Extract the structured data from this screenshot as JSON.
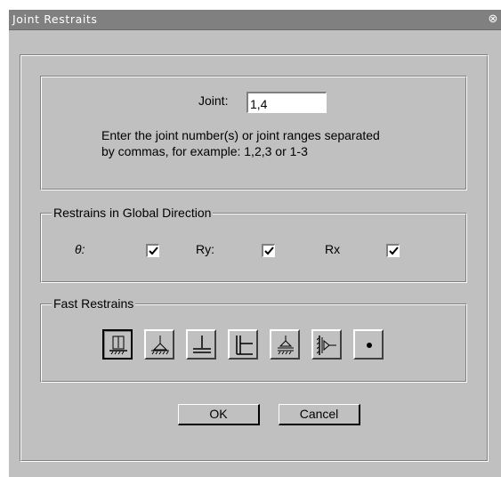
{
  "window": {
    "title": "Joint Restraits",
    "close_glyph": "⊗"
  },
  "joint": {
    "label": "Joint:",
    "value": "1,4",
    "help_line1": "Enter the joint number(s) or joint ranges separated",
    "help_line2": "by commas, for example: 1,2,3 or 1-3"
  },
  "restraints": {
    "group_title": "Restrains in Global Direction",
    "items": [
      {
        "label": "θ:",
        "checked": true
      },
      {
        "label": "Ry:",
        "checked": true
      },
      {
        "label": "Rx",
        "checked": true
      }
    ]
  },
  "fast": {
    "group_title": "Fast Restrains",
    "buttons": [
      {
        "icon": "fixed-support-icon"
      },
      {
        "icon": "pin-support-icon"
      },
      {
        "icon": "fixed-base-icon"
      },
      {
        "icon": "fixed-wall-icon"
      },
      {
        "icon": "roller-support-icon"
      },
      {
        "icon": "horizontal-roller-icon"
      },
      {
        "icon": "free-joint-icon"
      }
    ]
  },
  "actions": {
    "ok_label": "OK",
    "cancel_label": "Cancel"
  }
}
